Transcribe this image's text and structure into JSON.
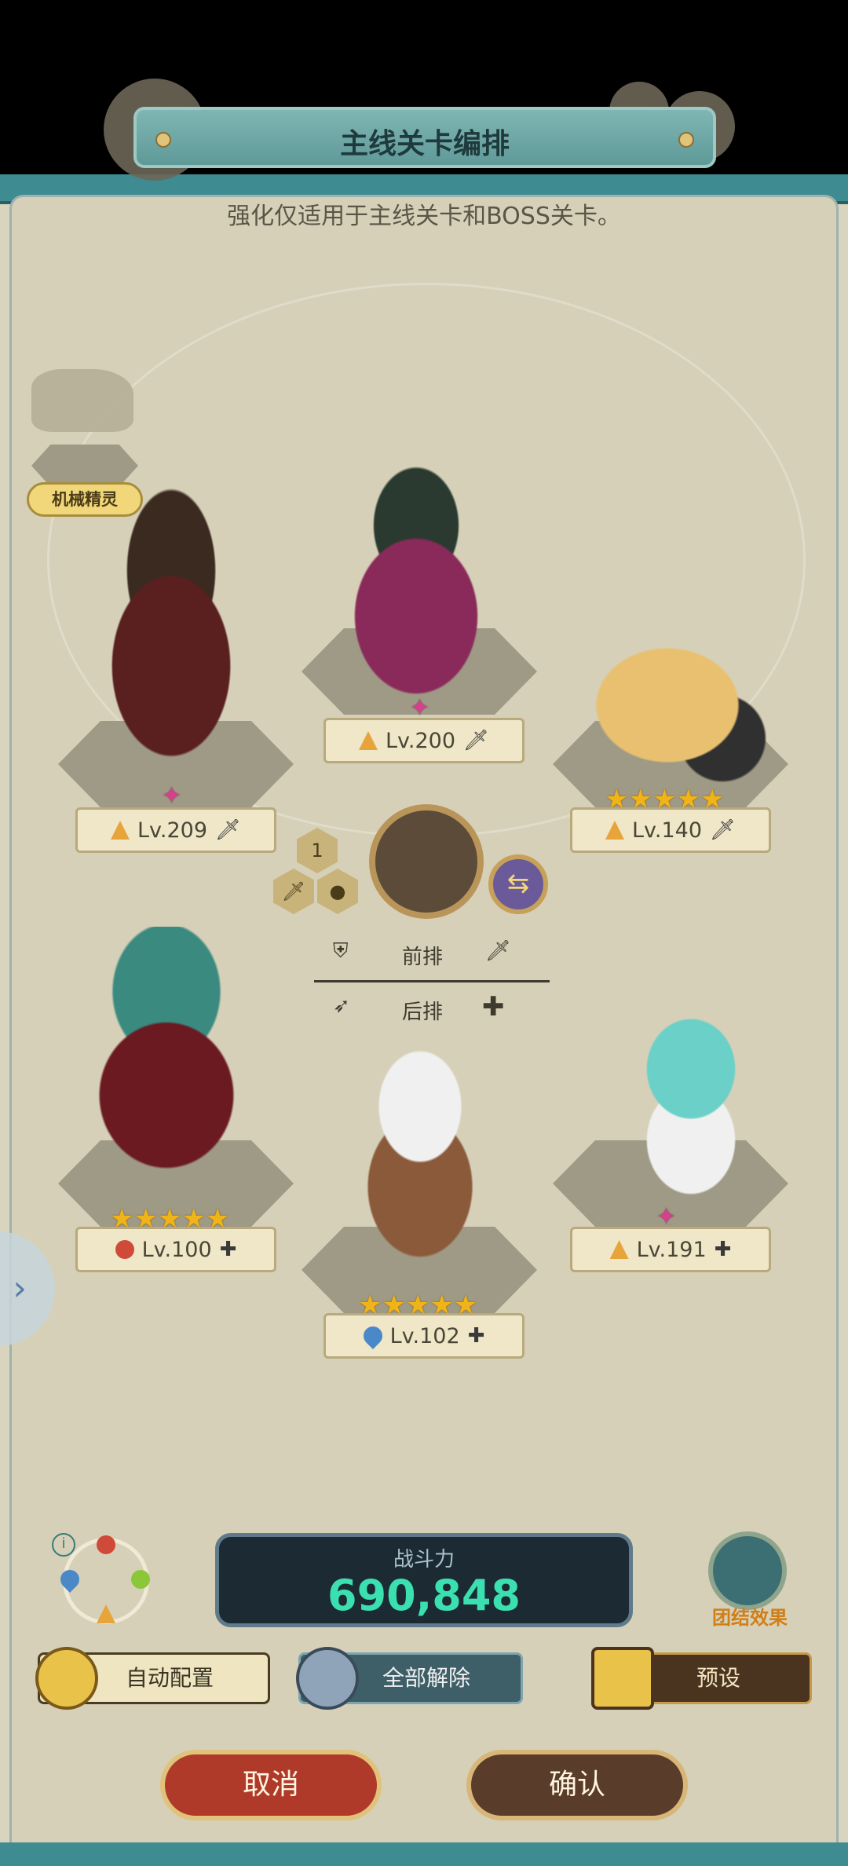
{
  "header": {
    "title": "主线关卡编排",
    "subtitle": "强化仅适用于主线关卡和BOSS关卡。"
  },
  "mech_label": "机械精灵",
  "heroes": [
    {
      "level": "Lv.209",
      "element": "earth",
      "mark": "sword",
      "rank": "pink"
    },
    {
      "level": "Lv.200",
      "element": "earth",
      "mark": "sword",
      "rank": "pink"
    },
    {
      "level": "Lv.140",
      "element": "earth",
      "mark": "sword",
      "stars": "★★★★★"
    },
    {
      "level": "Lv.100",
      "element": "fire",
      "mark": "plus",
      "stars": "★★★★★"
    },
    {
      "level": "Lv.102",
      "element": "water",
      "mark": "plus",
      "stars": "★★★★★"
    },
    {
      "level": "Lv.191",
      "element": "earth",
      "mark": "plus",
      "rank": "pink"
    }
  ],
  "center": {
    "slot_number": "1",
    "front_label": "前排",
    "back_label": "后排"
  },
  "power": {
    "label": "战斗力",
    "value": "690,848"
  },
  "unity": {
    "label": "团结效果"
  },
  "buttons": {
    "auto": "自动配置",
    "clear": "全部解除",
    "preset": "预设",
    "cancel": "取消",
    "confirm": "确认"
  },
  "icons": {
    "info": "i",
    "side_arrow": "›",
    "swap": "⇆",
    "pink_rank": "✦"
  }
}
